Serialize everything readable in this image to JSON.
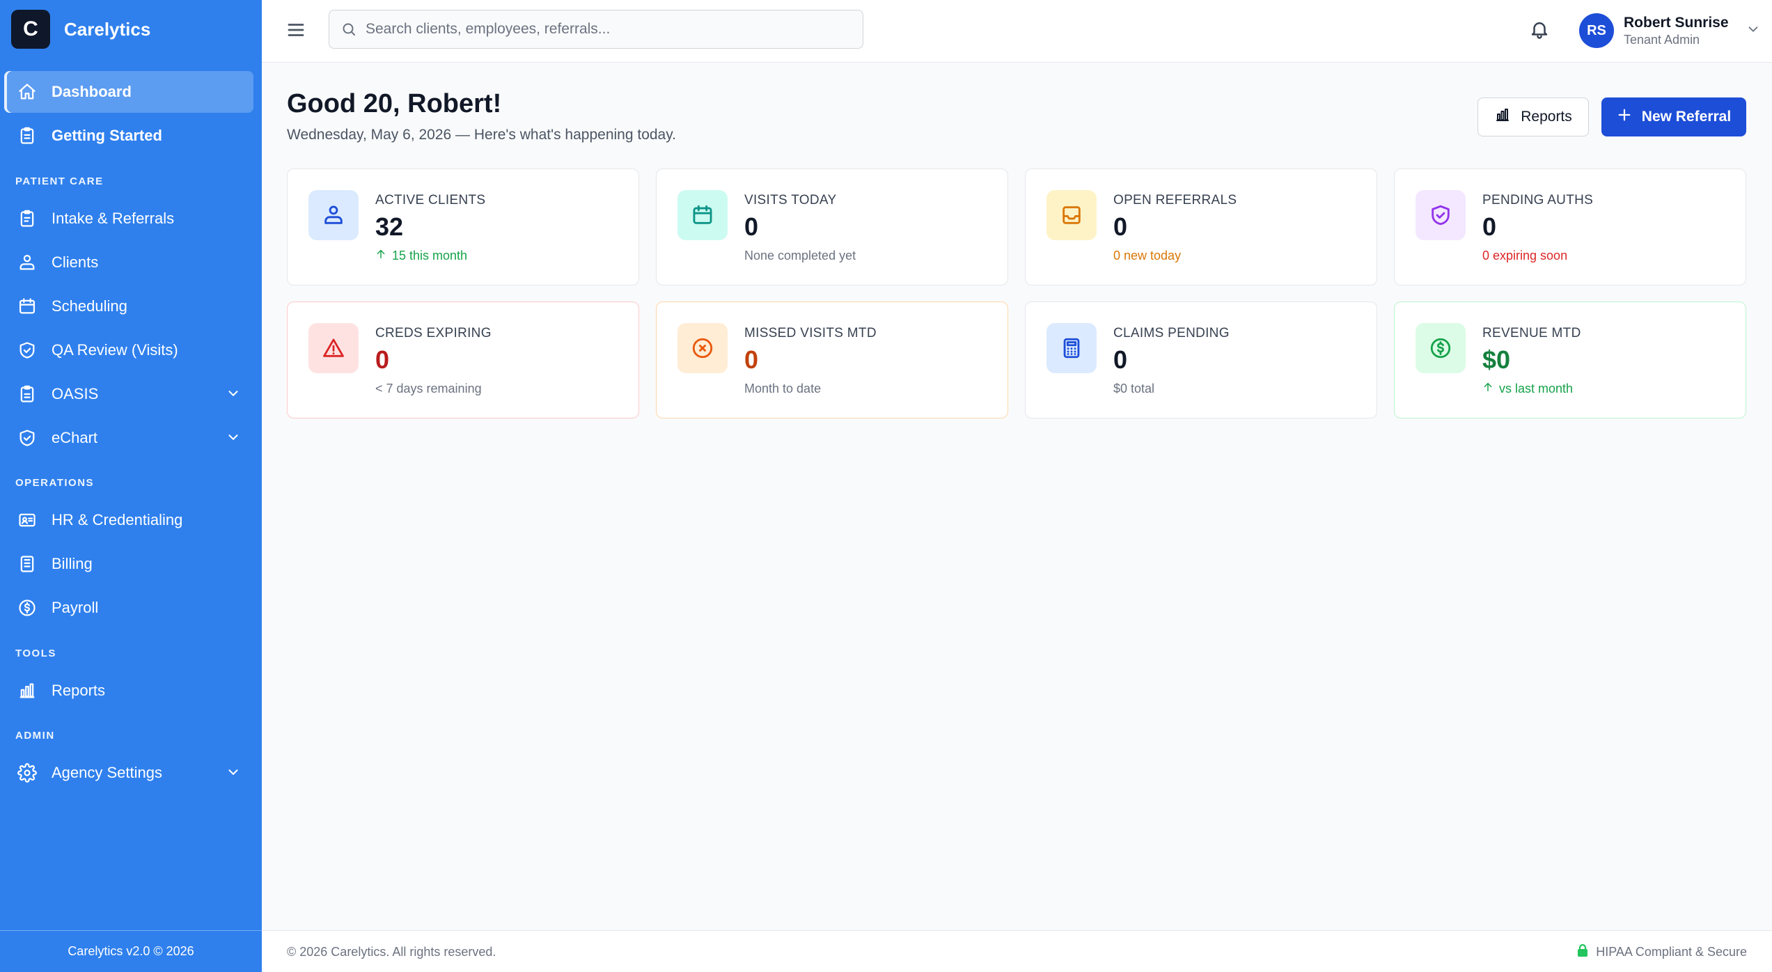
{
  "app": {
    "brand_letter": "C",
    "brand_name": "Carelytics",
    "version_footer": "Carelytics v2.0 © 2026",
    "accent_color": "#2f80ed",
    "primary_button_color": "#1d4ed8"
  },
  "sidebar": {
    "top_items": [
      {
        "label": "Dashboard",
        "icon": "home-icon",
        "active": true
      },
      {
        "label": "Getting Started",
        "icon": "clipboard-icon"
      }
    ],
    "sections": [
      {
        "title": "PATIENT CARE",
        "items": [
          {
            "label": "Intake & Referrals",
            "icon": "clipboard-list-icon"
          },
          {
            "label": "Clients",
            "icon": "users-icon"
          },
          {
            "label": "Scheduling",
            "icon": "calendar-icon"
          },
          {
            "label": "QA Review (Visits)",
            "icon": "shield-check-icon"
          },
          {
            "label": "OASIS",
            "icon": "clipboard-check-icon",
            "expandable": true
          },
          {
            "label": "eChart",
            "icon": "shield-check-icon",
            "expandable": true
          }
        ]
      },
      {
        "title": "OPERATIONS",
        "items": [
          {
            "label": "HR & Credentialing",
            "icon": "id-card-icon"
          },
          {
            "label": "Billing",
            "icon": "receipt-icon"
          },
          {
            "label": "Payroll",
            "icon": "dollar-circle-icon"
          }
        ]
      },
      {
        "title": "TOOLS",
        "items": [
          {
            "label": "Reports",
            "icon": "bar-chart-icon"
          }
        ]
      },
      {
        "title": "ADMIN",
        "items": [
          {
            "label": "Agency Settings",
            "icon": "gear-icon",
            "expandable": true
          }
        ]
      }
    ]
  },
  "topbar": {
    "search_placeholder": "Search clients, employees, referrals...",
    "search_value": "",
    "user": {
      "initials": "RS",
      "name": "Robert Sunrise",
      "role": "Tenant Admin"
    }
  },
  "main": {
    "greeting": "Good 20, Robert!",
    "subtitle": "Wednesday, May 6, 2026 — Here's what's happening today.",
    "reports_button": "Reports",
    "new_referral_button": "New Referral",
    "cards": [
      {
        "label": "ACTIVE CLIENTS",
        "value": "32",
        "sub": "15 this month",
        "icon": "users-icon",
        "tone": "blue",
        "sub_color": "#16a34a",
        "arrow": true
      },
      {
        "label": "VISITS TODAY",
        "value": "0",
        "sub": "None completed yet",
        "icon": "calendar-icon",
        "tone": "teal",
        "sub_color": "#6b7280"
      },
      {
        "label": "OPEN REFERRALS",
        "value": "0",
        "sub": "0 new today",
        "icon": "inbox-icon",
        "tone": "amber",
        "sub_color": "#d97706"
      },
      {
        "label": "PENDING AUTHS",
        "value": "0",
        "sub": "0 expiring soon",
        "icon": "shield-check-icon",
        "tone": "purple",
        "sub_color": "#dc2626"
      },
      {
        "label": "CREDS EXPIRING",
        "value": "0",
        "sub": "< 7 days remaining",
        "icon": "alert-triangle-icon",
        "tone": "red",
        "value_color": "#b91c1c",
        "sub_color": "#6b7280"
      },
      {
        "label": "MISSED VISITS MTD",
        "value": "0",
        "sub": "Month to date",
        "icon": "x-circle-icon",
        "tone": "orange",
        "value_color": "#c2410c",
        "sub_color": "#6b7280"
      },
      {
        "label": "CLAIMS PENDING",
        "value": "0",
        "sub": "$0 total",
        "icon": "calculator-icon",
        "tone": "indigo",
        "sub_color": "#6b7280"
      },
      {
        "label": "REVENUE MTD",
        "value": "$0",
        "sub": "vs last month",
        "icon": "dollar-circle-icon",
        "tone": "green",
        "value_color": "#15803d",
        "sub_color": "#16a34a",
        "arrow": true
      }
    ]
  },
  "footer": {
    "copyright": "© 2026 Carelytics. All rights reserved.",
    "compliance": "HIPAA Compliant & Secure"
  }
}
